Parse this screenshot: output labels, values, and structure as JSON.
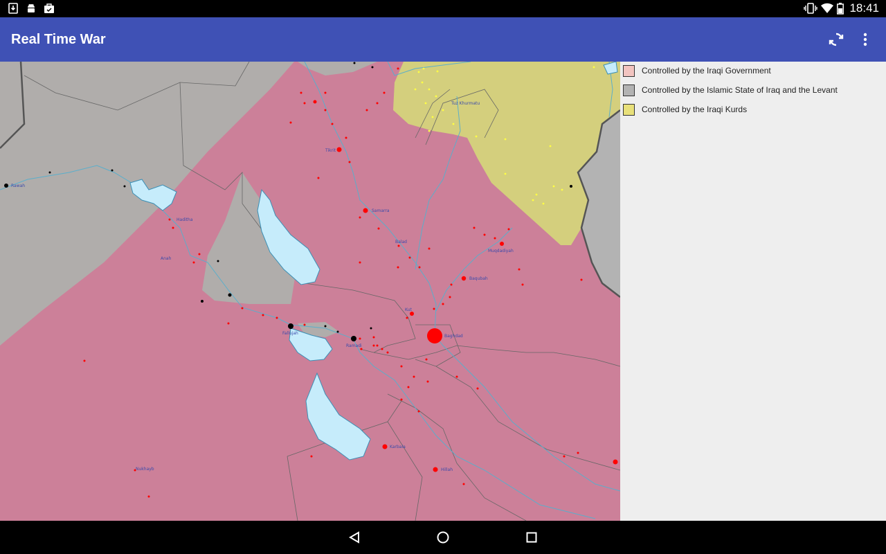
{
  "status_bar": {
    "time": "18:41",
    "left_icons": [
      "download-icon",
      "android-icon",
      "shopping-bag-icon"
    ],
    "right_icons": [
      "vibrate-icon",
      "wifi-icon",
      "battery-icon"
    ]
  },
  "app_bar": {
    "title": "Real Time War",
    "actions": [
      "refresh-icon",
      "more-vert-icon"
    ]
  },
  "legend": {
    "items": [
      {
        "label": "Controlled by the Iraqi Government",
        "color": "#f2c4c0"
      },
      {
        "label": "Controlled by the Islamic State of Iraq and the Levant",
        "color": "#b3b3b3"
      },
      {
        "label": "Controlled by the Iraqi Kurds",
        "color": "#e8e07a"
      }
    ]
  },
  "map": {
    "colors": {
      "government": "#cc8099",
      "isil": "#b0adab",
      "kurds": "#d4cf7d",
      "water": "#c6ecfb",
      "city_gov": "#ff0000",
      "city_isil": "#000000",
      "city_kurd": "#ffff44"
    },
    "labels": {
      "baghdad": "Baghdad",
      "tuz": "Tuz Khurmatu",
      "samarra": "Samarra",
      "balad": "Balad",
      "baqubah": "Baqubah",
      "fallujah": "Fallujah",
      "ramadi": "Ramadi",
      "haditha": "Haditha",
      "rawah": "Rawah",
      "anah": "Anah",
      "karbala": "Karbala",
      "hillah": "Hillah",
      "muqdadiyah": "Muqdadiyah",
      "tikrit": "Tikrit",
      "kut": "Kut",
      "nukhayb": "Nukhayb"
    }
  },
  "nav_bar": {
    "buttons": [
      "back-icon",
      "home-icon",
      "recents-icon"
    ]
  }
}
